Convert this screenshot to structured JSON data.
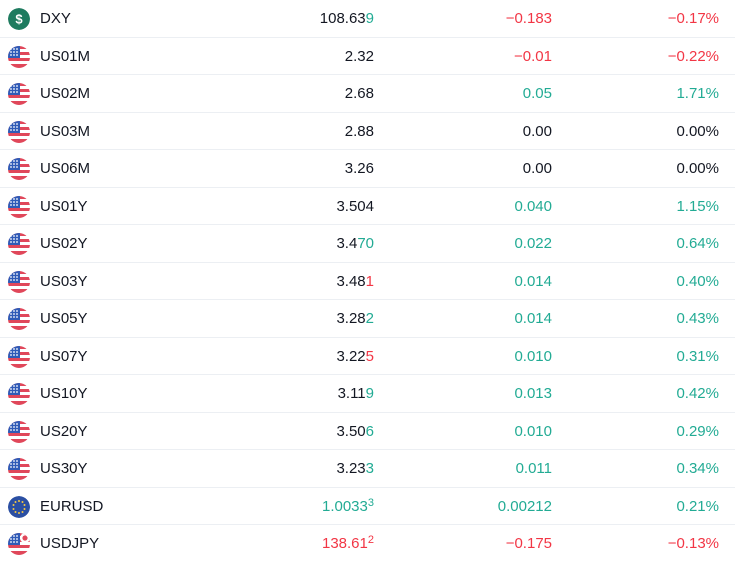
{
  "colors": {
    "up": "#22ab94",
    "down": "#f23645",
    "neutral": "#131722"
  },
  "rows": [
    {
      "symbol": "DXY",
      "icon": "dollar-icon",
      "last_base": "108.63",
      "last_tail": "9",
      "last_tail_dir": "up",
      "last_sup": false,
      "change": "−0.183",
      "change_dir": "down",
      "pct": "−0.17%",
      "pct_dir": "down"
    },
    {
      "symbol": "US01M",
      "icon": "us-flag-icon",
      "last_base": "2.32",
      "last_tail": "",
      "last_tail_dir": "neutral",
      "last_sup": false,
      "change": "−0.01",
      "change_dir": "down",
      "pct": "−0.22%",
      "pct_dir": "down"
    },
    {
      "symbol": "US02M",
      "icon": "us-flag-icon",
      "last_base": "2.68",
      "last_tail": "",
      "last_tail_dir": "neutral",
      "last_sup": false,
      "change": "0.05",
      "change_dir": "up",
      "pct": "1.71%",
      "pct_dir": "up"
    },
    {
      "symbol": "US03M",
      "icon": "us-flag-icon",
      "last_base": "2.88",
      "last_tail": "",
      "last_tail_dir": "neutral",
      "last_sup": false,
      "change": "0.00",
      "change_dir": "neutral",
      "pct": "0.00%",
      "pct_dir": "neutral"
    },
    {
      "symbol": "US06M",
      "icon": "us-flag-icon",
      "last_base": "3.26",
      "last_tail": "",
      "last_tail_dir": "neutral",
      "last_sup": false,
      "change": "0.00",
      "change_dir": "neutral",
      "pct": "0.00%",
      "pct_dir": "neutral"
    },
    {
      "symbol": "US01Y",
      "icon": "us-flag-icon",
      "last_base": "3.504",
      "last_tail": "",
      "last_tail_dir": "neutral",
      "last_sup": false,
      "change": "0.040",
      "change_dir": "up",
      "pct": "1.15%",
      "pct_dir": "up"
    },
    {
      "symbol": "US02Y",
      "icon": "us-flag-icon",
      "last_base": "3.4",
      "last_tail": "70",
      "last_tail_dir": "up",
      "last_sup": false,
      "change": "0.022",
      "change_dir": "up",
      "pct": "0.64%",
      "pct_dir": "up"
    },
    {
      "symbol": "US03Y",
      "icon": "us-flag-icon",
      "last_base": "3.48",
      "last_tail": "1",
      "last_tail_dir": "down",
      "last_sup": false,
      "change": "0.014",
      "change_dir": "up",
      "pct": "0.40%",
      "pct_dir": "up"
    },
    {
      "symbol": "US05Y",
      "icon": "us-flag-icon",
      "last_base": "3.28",
      "last_tail": "2",
      "last_tail_dir": "up",
      "last_sup": false,
      "change": "0.014",
      "change_dir": "up",
      "pct": "0.43%",
      "pct_dir": "up"
    },
    {
      "symbol": "US07Y",
      "icon": "us-flag-icon",
      "last_base": "3.22",
      "last_tail": "5",
      "last_tail_dir": "down",
      "last_sup": false,
      "change": "0.010",
      "change_dir": "up",
      "pct": "0.31%",
      "pct_dir": "up"
    },
    {
      "symbol": "US10Y",
      "icon": "us-flag-icon",
      "last_base": "3.11",
      "last_tail": "9",
      "last_tail_dir": "up",
      "last_sup": false,
      "change": "0.013",
      "change_dir": "up",
      "pct": "0.42%",
      "pct_dir": "up"
    },
    {
      "symbol": "US20Y",
      "icon": "us-flag-icon",
      "last_base": "3.50",
      "last_tail": "6",
      "last_tail_dir": "up",
      "last_sup": false,
      "change": "0.010",
      "change_dir": "up",
      "pct": "0.29%",
      "pct_dir": "up"
    },
    {
      "symbol": "US30Y",
      "icon": "us-flag-icon",
      "last_base": "3.23",
      "last_tail": "3",
      "last_tail_dir": "up",
      "last_sup": false,
      "change": "0.011",
      "change_dir": "up",
      "pct": "0.34%",
      "pct_dir": "up"
    },
    {
      "symbol": "EURUSD",
      "icon": "eu-us-flag-icon",
      "last_base": "1.0033",
      "last_tail": "3",
      "last_tail_dir": "up",
      "last_sup": true,
      "change": "0.00212",
      "change_dir": "up",
      "pct": "0.21%",
      "pct_dir": "up"
    },
    {
      "symbol": "USDJPY",
      "icon": "us-jp-flag-icon",
      "last_base": "138.61",
      "last_tail": "2",
      "last_tail_dir": "down",
      "last_sup": true,
      "change": "−0.175",
      "change_dir": "down",
      "pct": "−0.13%",
      "pct_dir": "down"
    }
  ]
}
